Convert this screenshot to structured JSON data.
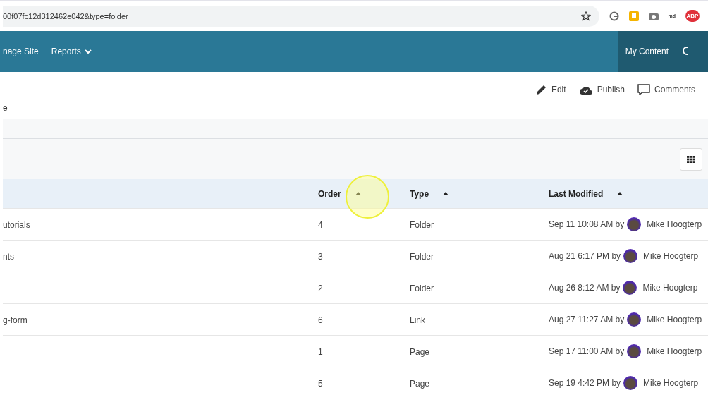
{
  "browser": {
    "url": "00f07fc12d312462e042&type=folder",
    "extensions": [
      {
        "kind": "refresh"
      },
      {
        "kind": "note"
      },
      {
        "kind": "camera"
      },
      {
        "kind": "text",
        "label": "md"
      },
      {
        "kind": "badge",
        "label": "ABP"
      }
    ]
  },
  "nav": {
    "items": [
      {
        "kind": "link",
        "label": "nage Site"
      },
      {
        "kind": "menu",
        "label": "Reports"
      }
    ],
    "my_content": "My Content"
  },
  "actions": [
    {
      "kind": "edit",
      "label": "Edit"
    },
    {
      "kind": "publish",
      "label": "Publish"
    },
    {
      "kind": "comments",
      "label": "Comments"
    }
  ],
  "breadcrumb": "e",
  "table": {
    "columns": [
      {
        "label": "Order"
      },
      {
        "label": "Type"
      },
      {
        "label": "Last Modified"
      }
    ],
    "rows": [
      {
        "name": "utorials",
        "order": "4",
        "type": "Folder",
        "modified": "Sep 11 10:08 AM by",
        "user": "Mike Hoogterp"
      },
      {
        "name": "nts",
        "order": "3",
        "type": "Folder",
        "modified": "Aug 21 6:17 PM by",
        "user": "Mike Hoogterp"
      },
      {
        "order": "2",
        "type": "Folder",
        "modified": "Aug 26 8:12 AM by",
        "user": "Mike Hoogterp"
      },
      {
        "name": "g-form",
        "order": "6",
        "type": "Link",
        "modified": "Aug 27 11:27 AM by",
        "user": "Mike Hoogterp"
      },
      {
        "order": "1",
        "type": "Page",
        "modified": "Sep 17 11:00 AM by",
        "user": "Mike Hoogterp"
      },
      {
        "order": "5",
        "type": "Page",
        "modified": "Sep 19 4:42 PM by",
        "user": "Mike Hoogterp"
      }
    ]
  }
}
